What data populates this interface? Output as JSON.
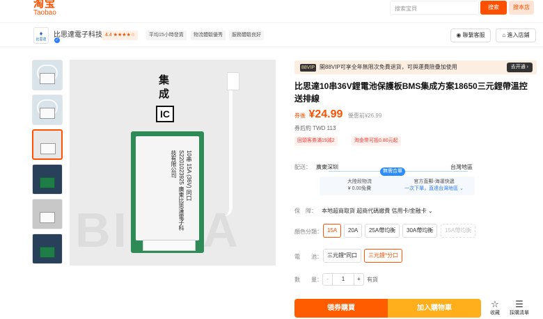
{
  "header": {
    "logo_cn": "淘宝",
    "logo_en": "Taobao",
    "search_placeholder": "搜索宝貝",
    "search_button": "搜索",
    "store_search_button": "搜本店"
  },
  "shop": {
    "avatar_text": "比思達",
    "name": "比思達電子科技",
    "rating": "4.4 ★★★★☆",
    "tags": [
      "平均15小時發貨",
      "物流體驗優秀",
      "服務體驗良好"
    ],
    "contact_button": "聯繫客服",
    "enter_button": "進入店鋪"
  },
  "product": {
    "image_text": {
      "vertical_title": "集成",
      "ic_label": "IC",
      "board_text": "10串 15A (36V) 同口 S2201023925 廣東比思達電子科技有限公司",
      "watermark": "BISDA"
    },
    "vip_banner": {
      "badge": "88VIP",
      "text": "開88VIP可享全年無限次免費退貨，可與運費險疊加使用",
      "link": "去开通 ›"
    },
    "title": "比思達10串36V鋰電池保護板BMS集成方案18650三元鋰帶溫控送排線",
    "price_label": "券後",
    "price": "¥24.99",
    "original_price": "優惠前¥26.99",
    "after_coupon": "券后約 TWD 113",
    "coupons": [
      "回頭客券滿19減2",
      "淘金幣可抵0.80元起"
    ],
    "delivery": {
      "label": "配送：",
      "from": "廣東深圳",
      "to": "台灣地區",
      "badge": "無需合單",
      "col1_title": "大陸段物流",
      "col1_value": "¥ 0.00免費",
      "col2_title": "官方直郵-海運快遞",
      "col2_value": "一次下單，直達台灣地區 ⌄"
    },
    "guarantee": {
      "label": "保　障：",
      "text": "本地超商取貨  超商代碼繳費  信用卡/金融卡 ⌄"
    },
    "color_label": "顏色分類：",
    "colors": [
      "15A",
      "20A",
      "25A帶均衡",
      "30A帶均衡",
      "15A帶均衡"
    ],
    "battery_label": "電　　池：",
    "batteries": [
      "三元鋰*同口",
      "三元鋰*分口"
    ],
    "quantity_label": "數　　量：",
    "quantity": "1",
    "stock": "有貨",
    "buy_now": "領券購買",
    "add_cart": "加入購物車",
    "favorite": "收藏",
    "list": "採購清單"
  }
}
